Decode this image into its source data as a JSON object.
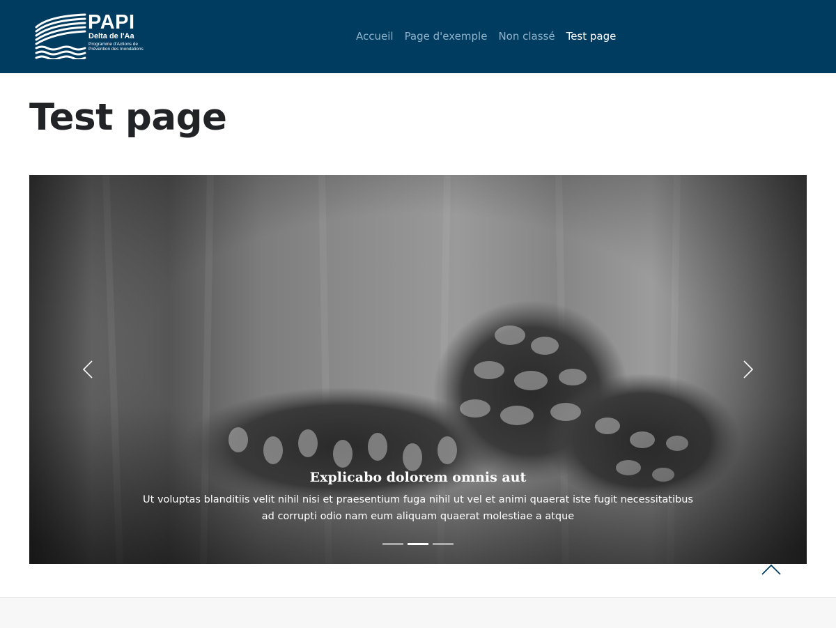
{
  "logo": {
    "title": "PAPI",
    "subtitle": "Delta de l'Aa",
    "tagline": "Programme d'Actions de Prévention des Inondations",
    "icon": "waves-logo-icon"
  },
  "nav": {
    "items": [
      {
        "label": "Accueil"
      },
      {
        "label": "Page d'exemple"
      },
      {
        "label": "Non classé"
      },
      {
        "label": "Test page"
      }
    ]
  },
  "page": {
    "title": "Test page"
  },
  "carousel": {
    "prev_icon": "chevron-left-icon",
    "next_icon": "chevron-right-icon",
    "caption_title": "Explicabo dolorem omnis aut",
    "caption_text": "Ut voluptas blanditiis velit nihil nisi et praesentium fuga nihil ut vel et animi quaerat iste fugit necessitatibus ad corrupti odio nam eum aliquam quaerat molestiae a atque",
    "slide_count": 3,
    "active_slide": 2
  },
  "back_to_top": {
    "icon": "chevron-up-icon"
  },
  "colors": {
    "header_bg": "#003b60",
    "nav_link": "#8fb3c9",
    "nav_active": "#ffffff",
    "title": "#222326",
    "footer_bg": "#f7f7f7"
  }
}
